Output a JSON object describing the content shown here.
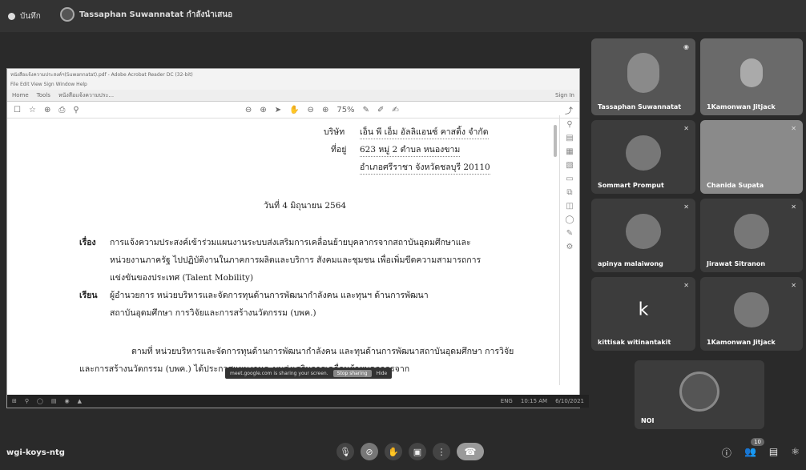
{
  "topbar": {
    "recording_label": "บันทึก",
    "presenter_label": "Tassaphan Suwannatat กำลังนำเสนอ"
  },
  "window": {
    "title": "หนังสือแจ้งความประสงค์ฯ(Suwannatat).pdf - Adobe Acrobat Reader DC (32-bit)",
    "menu": "File  Edit  View  Sign  Window  Help",
    "tabs": [
      "Home",
      "Tools",
      "หนังสือแจ้งความประ..."
    ],
    "sign_in": "Sign In",
    "zoom": "75%"
  },
  "letter": {
    "company_label": "บริษัท",
    "company_value": "เอ็น พี เอ็ม อัลลิแอนซ์ คาสติ้ง จำกัด",
    "address_label": "ที่อยู่",
    "address_line1": "623 หมู่ 2 ตำบล หนองขาม",
    "address_line2": "อำเภอศรีราชา จังหวัดชลบุรี 20110",
    "date": "วันที่  4 มิถุนายน 2564",
    "subject_label": "เรื่อง",
    "subject_line1": "การแจ้งความประสงค์เข้าร่วมแผนงานระบบส่งเสริมการเคลื่อนย้ายบุคลากรจากสถาบันอุดมศึกษาและ",
    "subject_line2": "หน่วยงานภาครัฐ ไปปฏิบัติงานในภาคการผลิตและบริการ สังคมและชุมชน เพื่อเพิ่มขีดความสามารถการ",
    "subject_line3": "แข่งขันของประเทศ (Talent Mobility)",
    "to_label": "เรียน",
    "to_line1": "ผู้อำนวยการ  หน่วยบริหารและจัดการทุนด้านการพัฒนากำลังคน  และทุนฯ ด้านการพัฒนา",
    "to_line2": "สถาบันอุดมศึกษา การวิจัยและการสร้างนวัตกรรม (บพค.)",
    "body_line1": "ตามที่ หน่วยบริหารและจัดการทุนด้านการพัฒนากำลังคน และทุนด้านการพัฒนาสถาบันอุดมศึกษา การวิจัย",
    "body_line2": "และการสร้างนวัตกรรม (บพค.) ได้ประกาศแผนงานระบบส่งเสริมการเคลื่อนย้ายบุคลากรจาก"
  },
  "share_notice": {
    "text": "meet.google.com is sharing your screen.",
    "stop_label": "Stop sharing",
    "hide_label": "Hide"
  },
  "taskbar": {
    "lang": "ENG",
    "time": "10:15 AM",
    "date": "6/10/2021"
  },
  "participants": [
    {
      "name": "Tassaphan Suwannatat",
      "type": "video"
    },
    {
      "name": "1Kamonwan Jitjack",
      "type": "video"
    },
    {
      "name": "Sommart Promput",
      "type": "avatar"
    },
    {
      "name": "Chanida Supata",
      "type": "blank"
    },
    {
      "name": "apinya malaiwong",
      "type": "avatar"
    },
    {
      "name": "Jirawat Sitranon",
      "type": "avatar"
    },
    {
      "name": "kittisak witinantakit",
      "type": "letter",
      "letter": "k"
    },
    {
      "name": "1Kamonwan Jitjack",
      "type": "avatar"
    },
    {
      "name": "NOI",
      "type": "avatar"
    }
  ],
  "bottom": {
    "meeting_code": "wgi-koys-ntg",
    "participant_count": "10"
  },
  "colors": {
    "background": "#2a2a2a",
    "tile": "#3c3c3c",
    "end_call": "#9a9a9a"
  }
}
